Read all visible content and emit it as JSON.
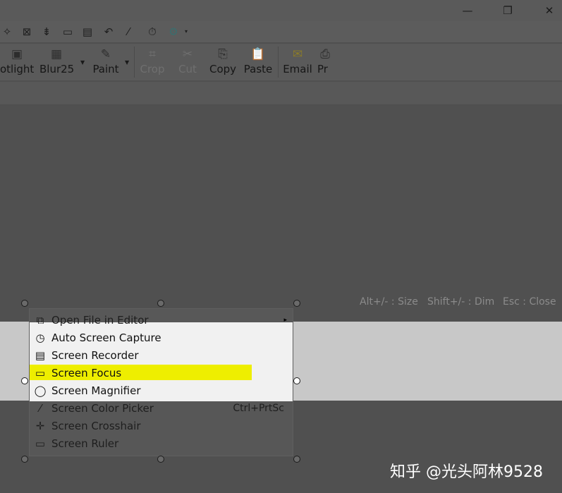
{
  "toolbar_icons": [
    {
      "name": "spotlight-tool-icon",
      "glyph": "✧"
    },
    {
      "name": "fullscreen-capture-icon",
      "glyph": "⊠"
    },
    {
      "name": "scrolling-capture-icon",
      "glyph": "⇟"
    },
    {
      "name": "region-capture-icon",
      "glyph": "▭"
    },
    {
      "name": "screen-recorder-icon",
      "glyph": "▤"
    },
    {
      "name": "repeat-capture-icon",
      "glyph": "↶"
    },
    {
      "name": "color-picker-icon",
      "glyph": "⁄"
    },
    {
      "name": "timer-icon",
      "glyph": "⏱"
    },
    {
      "name": "settings-gear-icon",
      "glyph": "⚙"
    }
  ],
  "ribbon": {
    "spotlight": "otlight",
    "blur": "Blur25",
    "paint": "Paint",
    "crop": "Crop",
    "cut": "Cut",
    "copy": "Copy",
    "paste": "Paste",
    "email": "Email",
    "print": "Pr"
  },
  "hints": {
    "size": "Alt+/- : Size",
    "dim": "Shift+/- : Dim",
    "close": "Esc : Close"
  },
  "menu": {
    "items": [
      {
        "label": "Open File in Editor",
        "icon": "⧉",
        "submenu": "▸"
      },
      {
        "label": "Auto Screen Capture",
        "icon": "◷"
      },
      {
        "label": "Screen Recorder",
        "icon": "▤"
      },
      {
        "label": "Screen Focus",
        "icon": "▭"
      },
      {
        "label": "Screen Magnifier",
        "icon": "◯"
      },
      {
        "label": "Screen Color Picker",
        "icon": "⁄",
        "shortcut": "Ctrl+PrtSc"
      },
      {
        "label": "Screen Crosshair",
        "icon": "✛"
      },
      {
        "label": "Screen Ruler",
        "icon": "▭"
      }
    ]
  },
  "watermark": "知乎 @光头阿林9528",
  "colors": {
    "highlight": "#eeee00",
    "focus_band": "#c8c8c8",
    "dim_overlay": "#505050"
  }
}
